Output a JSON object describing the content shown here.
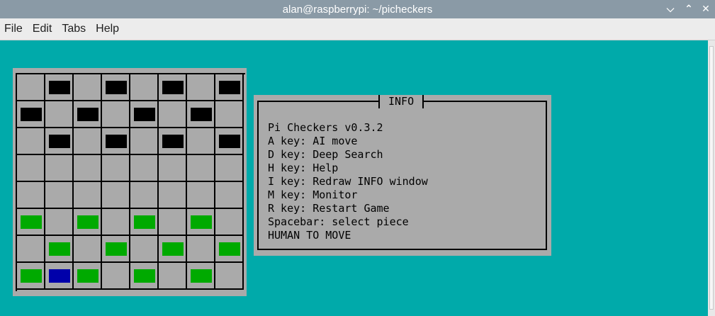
{
  "window": {
    "title": "alan@raspberrypi: ~/picheckers",
    "controls": [
      "chevron-down-icon",
      "chevron-up-icon",
      "close-icon"
    ]
  },
  "menu": {
    "items": [
      {
        "label": "File"
      },
      {
        "label": "Edit"
      },
      {
        "label": "Tabs"
      },
      {
        "label": "Help"
      }
    ]
  },
  "colors": {
    "terminal_bg": "#00aaaa",
    "board_bg": "#aaaaaa",
    "black_piece": "#000000",
    "green_piece": "#00aa00",
    "blue_piece": "#0000aa"
  },
  "board": {
    "rows": [
      [
        "",
        "B",
        "",
        "B",
        "",
        "B",
        "",
        "B"
      ],
      [
        "B",
        "",
        "B",
        "",
        "B",
        "",
        "B",
        ""
      ],
      [
        "",
        "B",
        "",
        "B",
        "",
        "B",
        "",
        "B"
      ],
      [
        "",
        "",
        "",
        "",
        "",
        "",
        "",
        ""
      ],
      [
        "",
        "",
        "",
        "",
        "",
        "",
        "",
        ""
      ],
      [
        "G",
        "",
        "G",
        "",
        "G",
        "",
        "G",
        ""
      ],
      [
        "",
        "G",
        "",
        "G",
        "",
        "G",
        "",
        "G"
      ],
      [
        "G",
        "S",
        "G",
        "",
        "G",
        "",
        "G",
        ""
      ]
    ]
  },
  "info": {
    "title": "INFO",
    "lines": [
      "Pi Checkers v0.3.2",
      "A key: AI move",
      "D key: Deep Search",
      "H key: Help",
      "I key: Redraw INFO window",
      "M key: Monitor",
      "R key: Restart Game",
      "Spacebar: select piece",
      "HUMAN TO MOVE"
    ]
  }
}
